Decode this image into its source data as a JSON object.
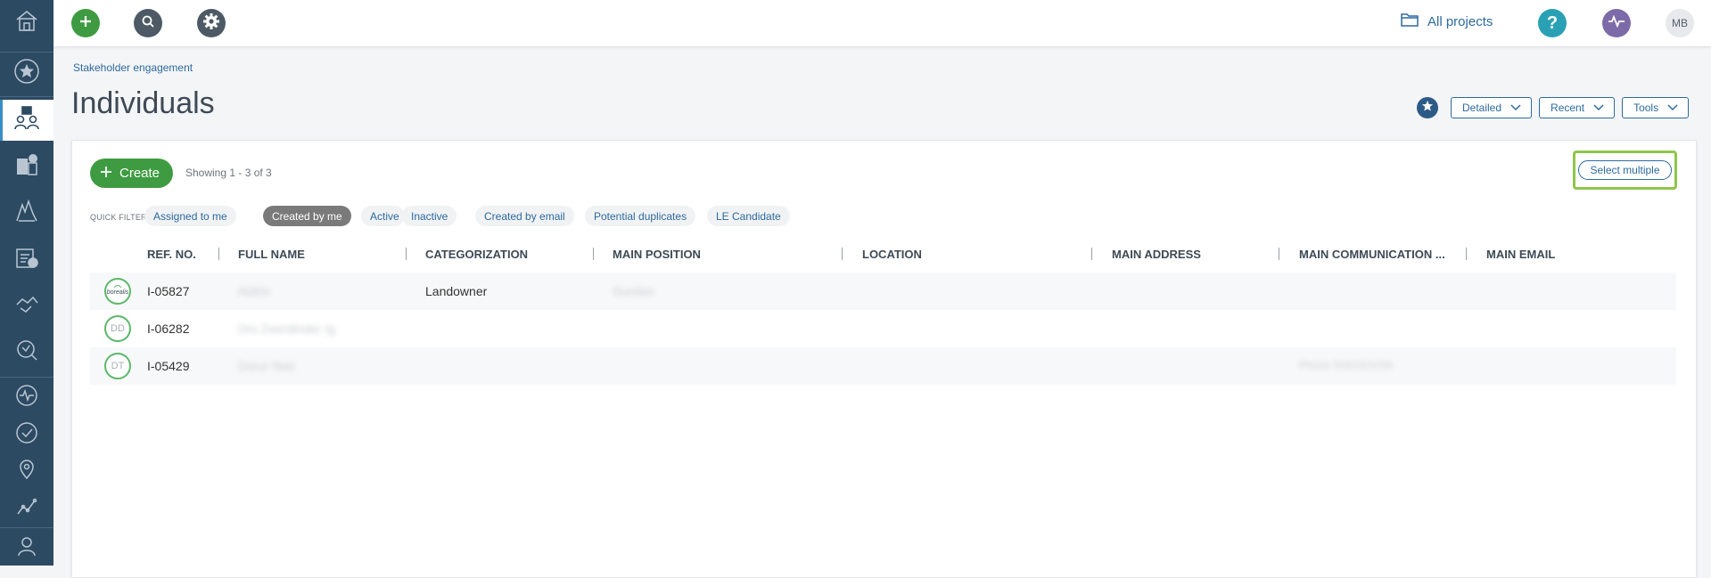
{
  "topbar": {
    "all_projects_label": "All projects",
    "user_initials": "MB",
    "add_color": "#3f9b41",
    "search_color": "#4d5a66",
    "settings_color": "#4d5a66",
    "help_color": "#2aa0b5",
    "activity_color": "#7d6aa8"
  },
  "sidebar": {
    "items": [
      {
        "icon": "home-icon"
      },
      {
        "icon": "star-icon"
      },
      {
        "icon": "stakeholders-icon",
        "active": true
      },
      {
        "icon": "organizations-icon"
      },
      {
        "icon": "land-icon"
      },
      {
        "icon": "tasks-icon"
      },
      {
        "icon": "handshake-icon"
      },
      {
        "icon": "grievance-icon"
      },
      {
        "icon": "activity-icon"
      },
      {
        "icon": "check-icon"
      },
      {
        "icon": "location-icon"
      },
      {
        "icon": "analytics-icon"
      },
      {
        "icon": "user-icon"
      }
    ]
  },
  "header": {
    "breadcrumb": "Stakeholder engagement",
    "title": "Individuals",
    "detailed_label": "Detailed",
    "recent_label": "Recent",
    "tools_label": "Tools"
  },
  "list": {
    "create_label": "Create",
    "showing_text": "Showing 1 - 3 of 3",
    "select_multiple_label": "Select multiple",
    "quick_filters_label": "QUICK FILTERS:",
    "filters": [
      {
        "label": "Assigned to me",
        "selected": false
      },
      {
        "label": "Created by me",
        "selected": true
      },
      {
        "label": "Active",
        "selected": false
      },
      {
        "label": "Inactive",
        "selected": false
      },
      {
        "label": "Created by email",
        "selected": false
      },
      {
        "label": "Potential duplicates",
        "selected": false
      },
      {
        "label": "LE Candidate",
        "selected": false
      }
    ],
    "columns": [
      "REF. NO.",
      "FULL NAME",
      "CATEGORIZATION",
      "MAIN POSITION",
      "LOCATION",
      "MAIN ADDRESS",
      "MAIN COMMUNICATION ...",
      "MAIN EMAIL"
    ],
    "rows": [
      {
        "avatar": "borealis",
        "ref": "I-05827",
        "full_name": "Aldrin",
        "categorization": "Landowner",
        "main_position": "Gordon",
        "main_communication": ""
      },
      {
        "avatar": "DD",
        "ref": "I-06282",
        "full_name": "Drs Zeerdinder Ig",
        "categorization": "",
        "main_position": "",
        "main_communication": ""
      },
      {
        "avatar": "DT",
        "ref": "I-05429",
        "full_name": "Dorui Teel",
        "categorization": "",
        "main_position": "",
        "main_communication": "Phone 3191321234"
      }
    ]
  }
}
